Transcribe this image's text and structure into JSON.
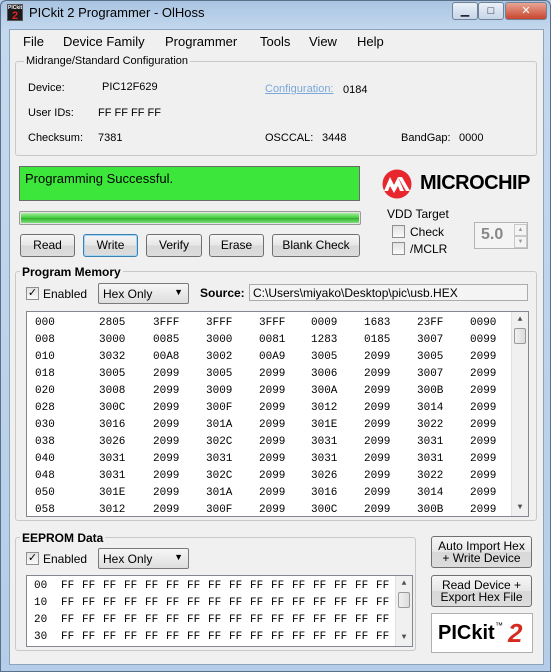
{
  "window": {
    "title": "PICkit 2 Programmer - OlHoss",
    "icon_text_top": "PICkit",
    "icon_text_num": "2"
  },
  "menu": [
    "File",
    "Device Family",
    "Programmer",
    "Tools",
    "View",
    "Help"
  ],
  "config": {
    "group_title": "Midrange/Standard Configuration",
    "device_label": "Device:",
    "device_value": "PIC12F629",
    "configuration_label": "Configuration:",
    "configuration_value": "0184",
    "userids_label": "User IDs:",
    "userids_value": "FF FF FF FF",
    "checksum_label": "Checksum:",
    "checksum_value": "7381",
    "osccal_label": "OSCCAL:",
    "osccal_value": "3448",
    "bandgap_label": "BandGap:",
    "bandgap_value": "0000"
  },
  "status": {
    "message": "Programming Successful.",
    "color": "#3ce63a",
    "progress": 1.0
  },
  "buttons": {
    "read": "Read",
    "write": "Write",
    "verify": "Verify",
    "erase": "Erase",
    "blank_check": "Blank Check"
  },
  "logo": {
    "brand": "MICROCHIP",
    "brand_color": "#e8262d"
  },
  "vdd": {
    "title": "VDD Target",
    "check_label": "Check",
    "mclr_label": "/MCLR",
    "check_checked": false,
    "mclr_checked": false,
    "voltage": "5.0"
  },
  "program_memory": {
    "title": "Program Memory",
    "enabled_label": "Enabled",
    "enabled": true,
    "view_mode": "Hex Only",
    "source_label": "Source:",
    "source_path": "C:\\Users\\miyako\\Desktop\\pic\\usb.HEX",
    "rows": [
      {
        "addr": "000",
        "words": [
          "2805",
          "3FFF",
          "3FFF",
          "3FFF",
          "0009",
          "1683",
          "23FF",
          "0090"
        ]
      },
      {
        "addr": "008",
        "words": [
          "3000",
          "0085",
          "3000",
          "0081",
          "1283",
          "0185",
          "3007",
          "0099"
        ]
      },
      {
        "addr": "010",
        "words": [
          "3032",
          "00A8",
          "3002",
          "00A9",
          "3005",
          "2099",
          "3005",
          "2099"
        ]
      },
      {
        "addr": "018",
        "words": [
          "3005",
          "2099",
          "3005",
          "2099",
          "3006",
          "2099",
          "3007",
          "2099"
        ]
      },
      {
        "addr": "020",
        "words": [
          "3008",
          "2099",
          "3009",
          "2099",
          "300A",
          "2099",
          "300B",
          "2099"
        ]
      },
      {
        "addr": "028",
        "words": [
          "300C",
          "2099",
          "300F",
          "2099",
          "3012",
          "2099",
          "3014",
          "2099"
        ]
      },
      {
        "addr": "030",
        "words": [
          "3016",
          "2099",
          "301A",
          "2099",
          "301E",
          "2099",
          "3022",
          "2099"
        ]
      },
      {
        "addr": "038",
        "words": [
          "3026",
          "2099",
          "302C",
          "2099",
          "3031",
          "2099",
          "3031",
          "2099"
        ]
      },
      {
        "addr": "040",
        "words": [
          "3031",
          "2099",
          "3031",
          "2099",
          "3031",
          "2099",
          "3031",
          "2099"
        ]
      },
      {
        "addr": "048",
        "words": [
          "3031",
          "2099",
          "302C",
          "2099",
          "3026",
          "2099",
          "3022",
          "2099"
        ]
      },
      {
        "addr": "050",
        "words": [
          "301E",
          "2099",
          "301A",
          "2099",
          "3016",
          "2099",
          "3014",
          "2099"
        ]
      },
      {
        "addr": "058",
        "words": [
          "3012",
          "2099",
          "300F",
          "2099",
          "300C",
          "2099",
          "300B",
          "2099"
        ]
      }
    ]
  },
  "eeprom": {
    "title": "EEPROM Data",
    "enabled_label": "Enabled",
    "enabled": true,
    "view_mode": "Hex Only",
    "rows": [
      {
        "addr": "00",
        "bytes": [
          "FF",
          "FF",
          "FF",
          "FF",
          "FF",
          "FF",
          "FF",
          "FF",
          "FF",
          "FF",
          "FF",
          "FF",
          "FF",
          "FF",
          "FF",
          "FF"
        ]
      },
      {
        "addr": "10",
        "bytes": [
          "FF",
          "FF",
          "FF",
          "FF",
          "FF",
          "FF",
          "FF",
          "FF",
          "FF",
          "FF",
          "FF",
          "FF",
          "FF",
          "FF",
          "FF",
          "FF"
        ]
      },
      {
        "addr": "20",
        "bytes": [
          "FF",
          "FF",
          "FF",
          "FF",
          "FF",
          "FF",
          "FF",
          "FF",
          "FF",
          "FF",
          "FF",
          "FF",
          "FF",
          "FF",
          "FF",
          "FF"
        ]
      },
      {
        "addr": "30",
        "bytes": [
          "FF",
          "FF",
          "FF",
          "FF",
          "FF",
          "FF",
          "FF",
          "FF",
          "FF",
          "FF",
          "FF",
          "FF",
          "FF",
          "FF",
          "FF",
          "FF"
        ]
      }
    ]
  },
  "side_buttons": {
    "auto_import_line1": "Auto Import Hex",
    "auto_import_line2": "+ Write Device",
    "read_export_line1": "Read Device +",
    "read_export_line2": "Export Hex File"
  },
  "pickit_logo": {
    "text": "PICkit",
    "tm": "™",
    "num": "2",
    "num_color": "#d42a20"
  }
}
